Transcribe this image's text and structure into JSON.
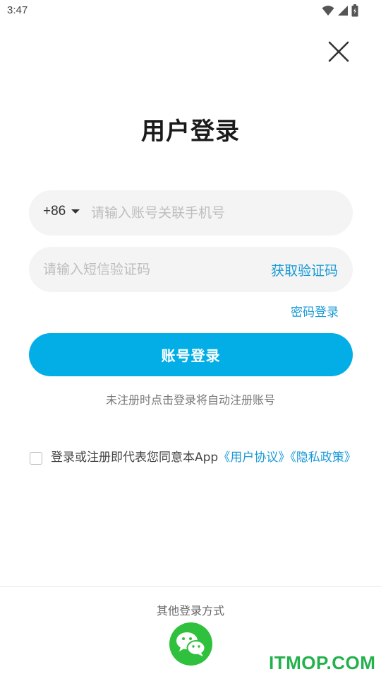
{
  "status_bar": {
    "time": "3:47",
    "icons": [
      "wifi-icon",
      "signal-icon",
      "battery-icon"
    ]
  },
  "header": {
    "close_icon": "close-icon"
  },
  "title": "用户登录",
  "phone": {
    "country_code": "+86",
    "placeholder": "请输入账号关联手机号",
    "value": ""
  },
  "sms_code": {
    "placeholder": "请输入短信验证码",
    "value": "",
    "get_code_label": "获取验证码"
  },
  "password_login_link": "密码登录",
  "login_button": "账号登录",
  "auto_register_hint": "未注册时点击登录将自动注册账号",
  "agreement": {
    "checked": false,
    "prefix": "登录或注册即代表您同意本App",
    "user_agreement": "《用户协议》",
    "privacy_policy": "《隐私政策》"
  },
  "other_login": {
    "title": "其他登录方式",
    "methods": [
      "wechat-icon"
    ]
  },
  "watermark": "ITMOP.COM",
  "colors": {
    "accent": "#03aee6",
    "link": "#1a9ad6",
    "field_bg": "#f4f4f4",
    "wechat": "#2fc13d",
    "watermark": "#23b14d"
  }
}
